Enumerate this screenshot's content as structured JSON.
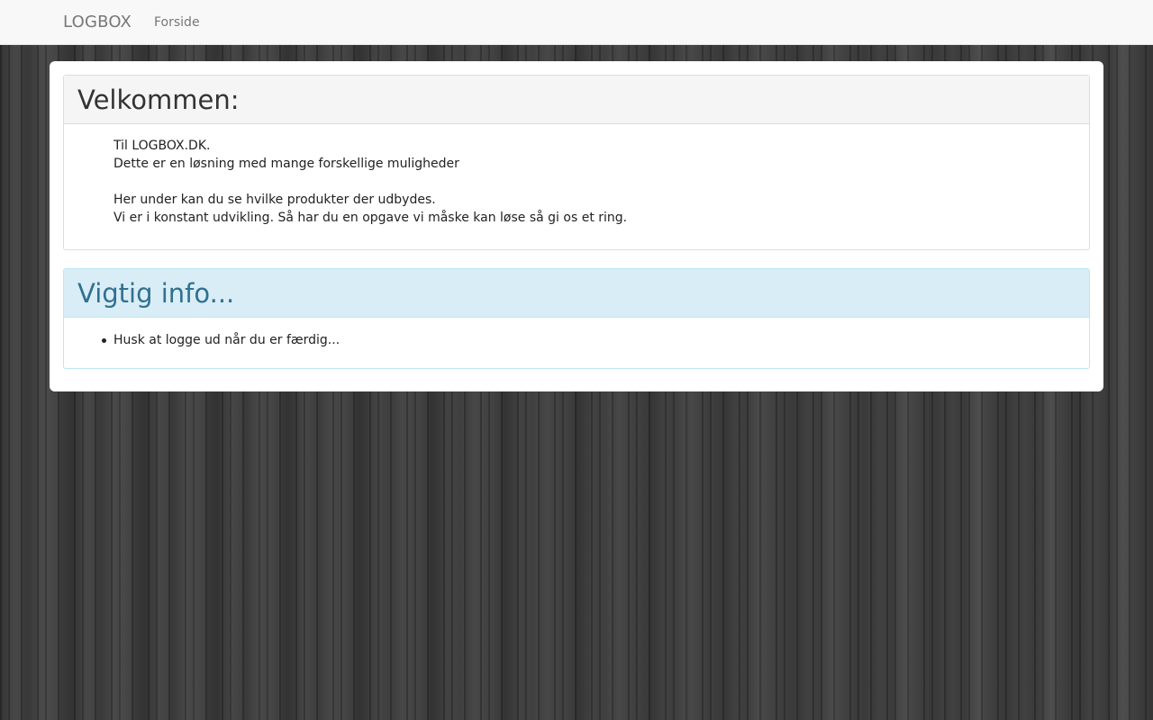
{
  "navbar": {
    "brand": "LOGBOX",
    "links": [
      {
        "label": "Forside"
      }
    ]
  },
  "welcome": {
    "title": "Velkommen:",
    "paragraph1": [
      "Til LOGBOX.DK.",
      "Dette er en løsning med mange forskellige muligheder"
    ],
    "paragraph2": [
      "Her under kan du se hvilke produkter der udbydes.",
      "Vi er i konstant udvikling. Så har du en opgave vi måske kan løse så gi os et ring."
    ]
  },
  "info": {
    "title": "Vigtig info...",
    "items": [
      "Husk at logge ud når du er færdig..."
    ]
  },
  "colors": {
    "info_heading_bg": "#d9edf7",
    "info_heading_text": "#31708f",
    "navbar_bg": "#f8f8f8"
  }
}
